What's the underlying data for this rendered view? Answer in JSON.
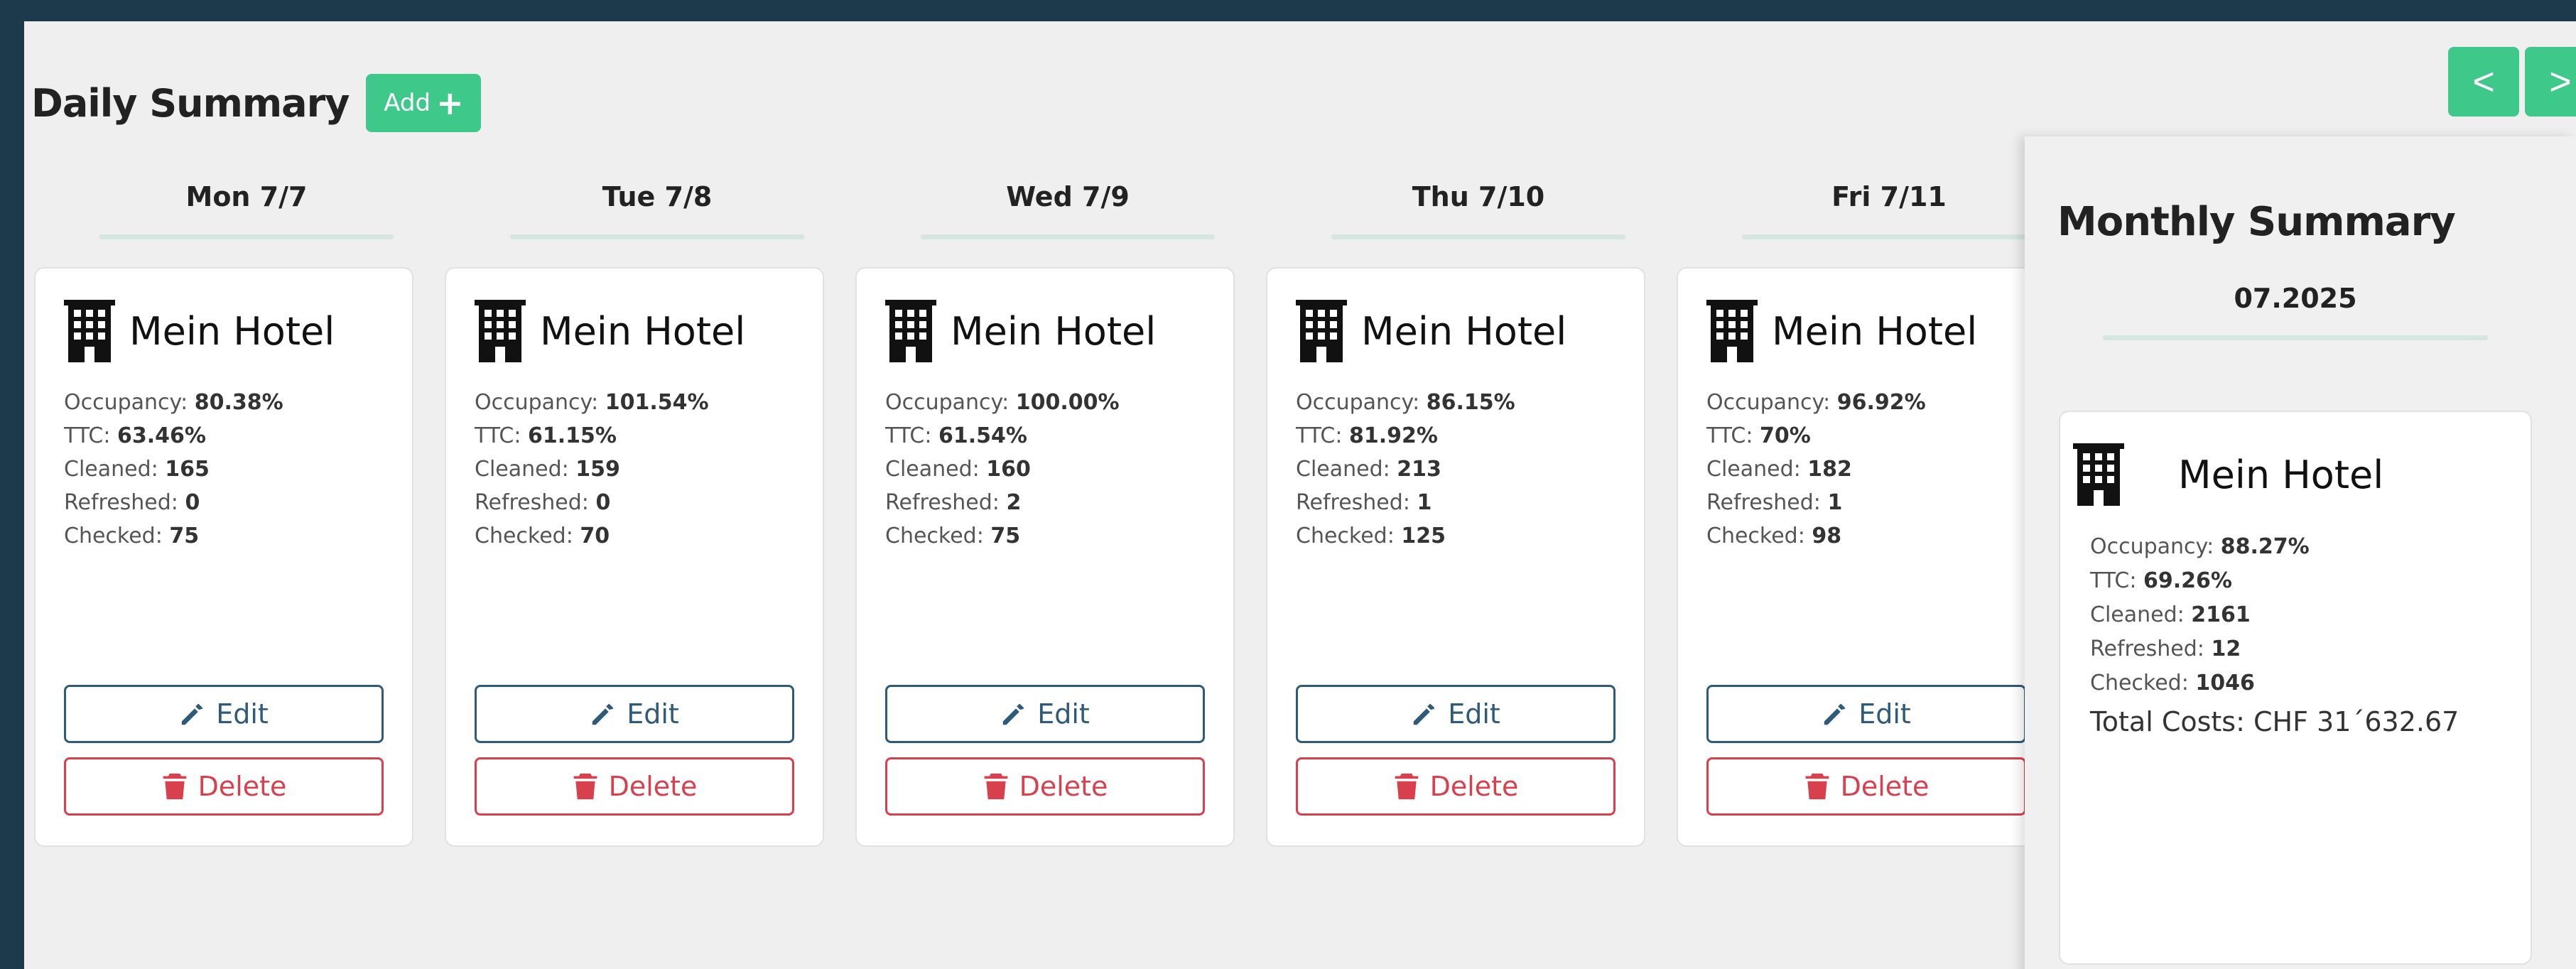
{
  "header": {
    "title": "Daily Summary",
    "add_label": "Add",
    "add_icon": "plus-icon"
  },
  "nav": {
    "prev_label": "<",
    "next_label": ">"
  },
  "labels": {
    "occupancy": "Occupancy:",
    "ttc": "TTC:",
    "cleaned": "Cleaned:",
    "refreshed": "Refreshed:",
    "checked": "Checked:",
    "edit": "Edit",
    "delete": "Delete"
  },
  "colors": {
    "accent": "#3ec98a",
    "edit": "#2e5a7c",
    "delete": "#d9404e",
    "background": "#efefef"
  },
  "days": [
    {
      "label": "Mon 7/7",
      "hotel": "Mein Hotel",
      "occupancy": "80.38%",
      "ttc": "63.46%",
      "cleaned": "165",
      "refreshed": "0",
      "checked": "75"
    },
    {
      "label": "Tue 7/8",
      "hotel": "Mein Hotel",
      "occupancy": "101.54%",
      "ttc": "61.15%",
      "cleaned": "159",
      "refreshed": "0",
      "checked": "70"
    },
    {
      "label": "Wed 7/9",
      "hotel": "Mein Hotel",
      "occupancy": "100.00%",
      "ttc": "61.54%",
      "cleaned": "160",
      "refreshed": "2",
      "checked": "75"
    },
    {
      "label": "Thu 7/10",
      "hotel": "Mein Hotel",
      "occupancy": "86.15%",
      "ttc": "81.92%",
      "cleaned": "213",
      "refreshed": "1",
      "checked": "125"
    },
    {
      "label": "Fri 7/11",
      "hotel": "Mein Hotel",
      "occupancy": "96.92%",
      "ttc": "70%",
      "cleaned": "182",
      "refreshed": "1",
      "checked": "98"
    }
  ],
  "monthly": {
    "title": "Monthly Summary",
    "month": "07.2025",
    "hotel": "Mein Hotel",
    "occupancy": "88.27%",
    "ttc": "69.26%",
    "cleaned": "2161",
    "refreshed": "12",
    "checked": "1046",
    "total_costs": "Total Costs: CHF 31´632.67"
  }
}
